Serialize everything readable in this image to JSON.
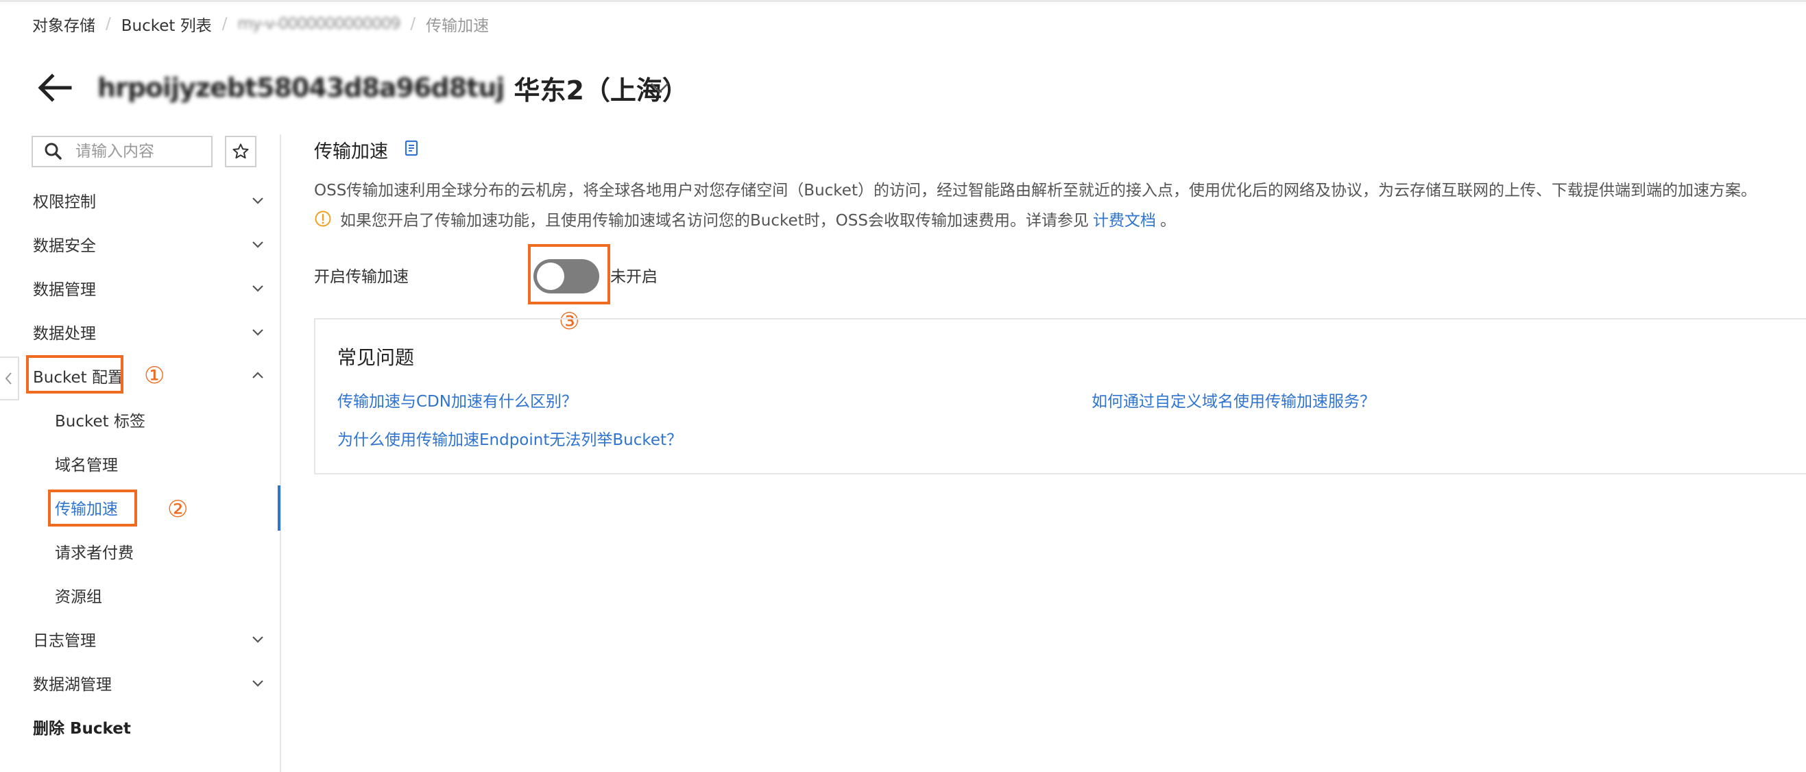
{
  "breadcrumb": {
    "items": [
      "对象存储",
      "Bucket 列表",
      "my-v-0000000000009",
      "传输加速"
    ],
    "separator": "/"
  },
  "header": {
    "bucket_name": "hrpoijyzebt58043d8a96d8tuj",
    "region": "华东2（上海）"
  },
  "sidebar": {
    "search_placeholder": "请输入内容",
    "items": [
      {
        "label": "权限控制"
      },
      {
        "label": "数据安全"
      },
      {
        "label": "数据管理"
      },
      {
        "label": "数据处理"
      },
      {
        "label": "Bucket 配置"
      },
      {
        "label": "Bucket 标签"
      },
      {
        "label": "域名管理"
      },
      {
        "label": "传输加速"
      },
      {
        "label": "请求者付费"
      },
      {
        "label": "资源组"
      },
      {
        "label": "日志管理"
      },
      {
        "label": "数据湖管理"
      },
      {
        "label": "删除 Bucket"
      }
    ],
    "active_item": "传输加速"
  },
  "main": {
    "title": "传输加速",
    "description": "OSS传输加速利用全球分布的云机房，将全球各地用户对您存储空间（Bucket）的访问，经过智能路由解析至就近的接入点，使用优化后的网络及协议，为云存储互联网的上传、下载提供端到端的加速方案。",
    "notice_prefix": "如果您开启了传输加速功能，且使用传输加速域名访问您的Bucket时，OSS会收取传输加速费用。详请参见",
    "notice_link": "计费文档",
    "notice_suffix": "。",
    "toggle_label": "开启传输加速",
    "toggle_status": "未开启",
    "toggle_on": false,
    "faq_title": "常见问题",
    "faq_links": [
      "传输加速与CDN加速有什么区别？",
      "如何通过自定义域名使用传输加速服务？",
      "为什么使用传输加速Endpoint无法列举Bucket？"
    ]
  },
  "annotations": {
    "step1": "①",
    "step2": "②",
    "step3": "③"
  },
  "colors": {
    "accent": "#2f74d0",
    "highlight": "#ef6b1f",
    "toggle_off": "#7d7d7d"
  }
}
